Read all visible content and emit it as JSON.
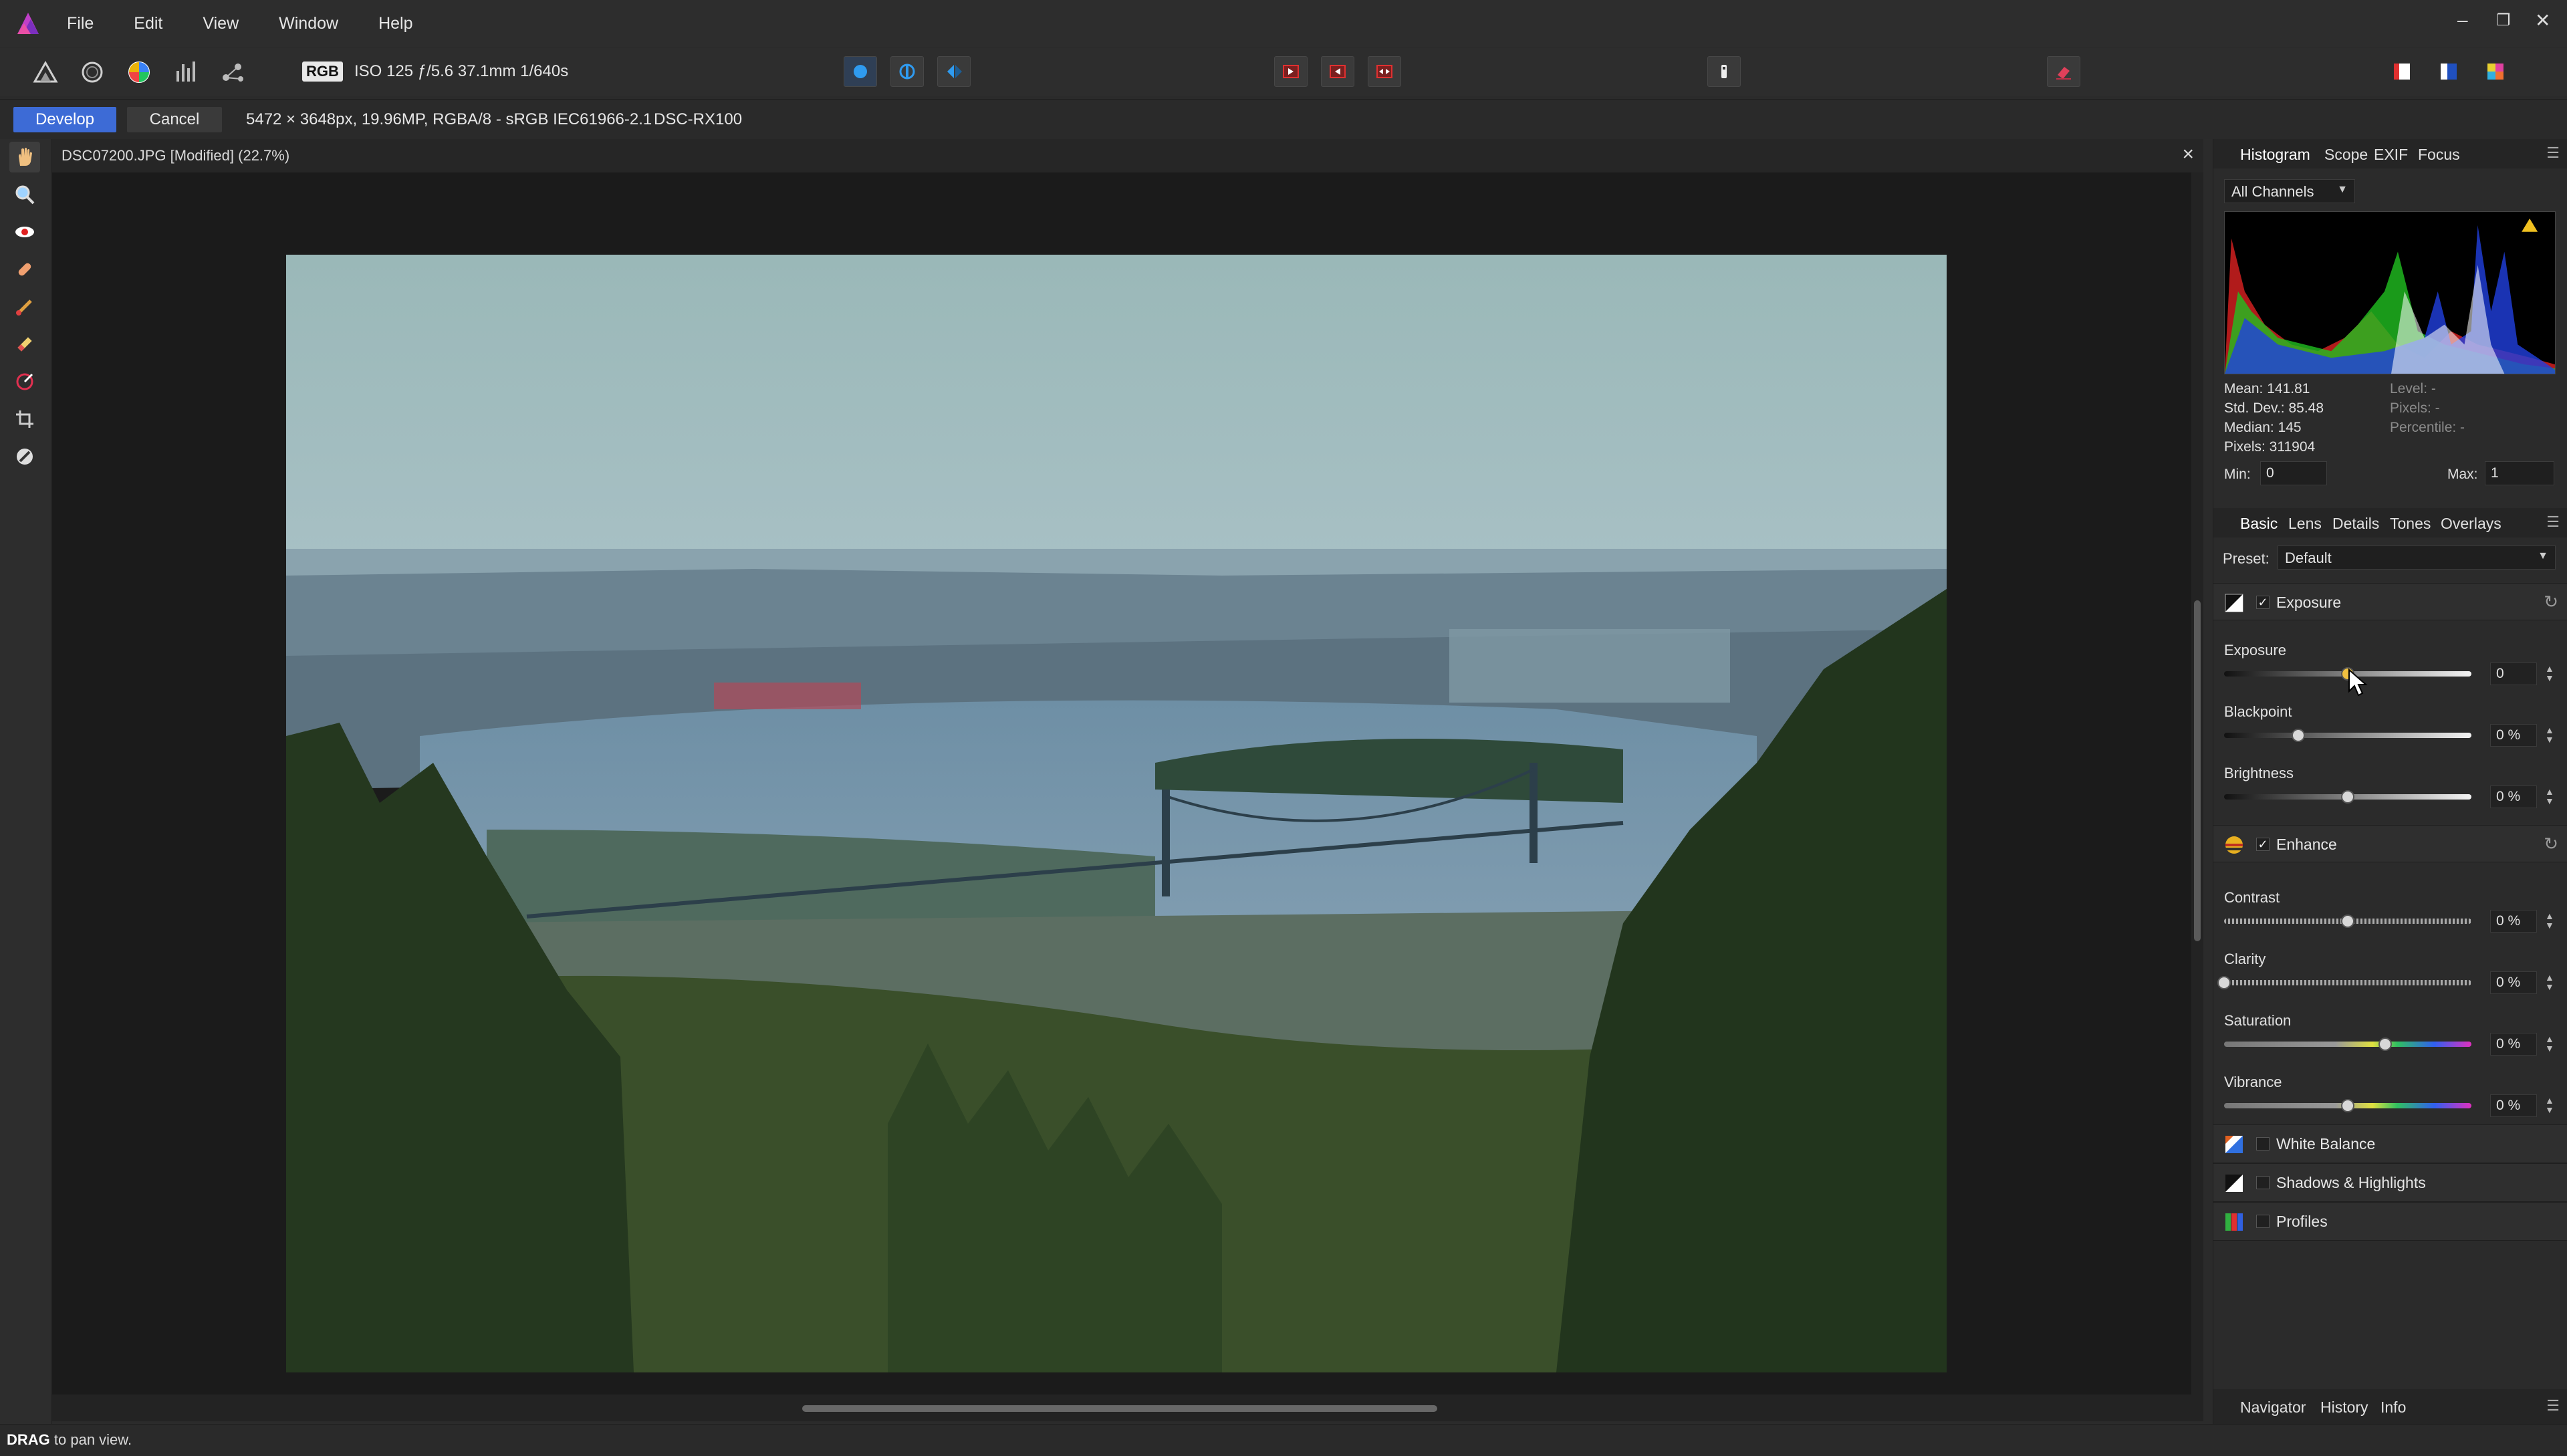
{
  "menubar": {
    "items": [
      "File",
      "Edit",
      "View",
      "Window",
      "Help"
    ],
    "window_controls": [
      "–",
      "❐",
      "✕"
    ]
  },
  "toolbar": {
    "color_mode": "RGB",
    "exif_summary": "ISO 125 ƒ/5.6 37.1mm 1/640s"
  },
  "context_bar": {
    "develop_label": "Develop",
    "cancel_label": "Cancel",
    "image_info": "5472 × 3648px, 19.96MP, RGBA/8 - sRGB IEC61966-2.1",
    "camera": "DSC-RX100"
  },
  "document": {
    "title": "DSC07200.JPG [Modified] (22.7%)",
    "close": "×"
  },
  "status": {
    "bold": "DRAG",
    "text": " to pan view."
  },
  "histogram_panel": {
    "tabs": [
      "Histogram",
      "Scope",
      "EXIF",
      "Focus"
    ],
    "channel": "All Channels",
    "stats": {
      "mean": "Mean: 141.81",
      "std": "Std. Dev.: 85.48",
      "median": "Median: 145",
      "pixels": "Pixels: 311904",
      "level": "Level: -",
      "pixels_sel": "Pixels: -",
      "percentile": "Percentile: -"
    },
    "min_label": "Min:",
    "min_value": "0",
    "max_label": "Max:",
    "max_value": "1"
  },
  "develop_panel": {
    "tabs": [
      "Basic",
      "Lens",
      "Details",
      "Tones",
      "Overlays"
    ],
    "preset_label": "Preset:",
    "preset_value": "Default",
    "sections": {
      "exposure": "Exposure",
      "enhance": "Enhance",
      "white_balance": "White Balance",
      "shadows_highlights": "Shadows & Highlights",
      "profiles": "Profiles"
    },
    "sliders": [
      {
        "label": "Exposure",
        "value": "0",
        "position": 0.5
      },
      {
        "label": "Blackpoint",
        "value": "0 %",
        "position": 0.3
      },
      {
        "label": "Brightness",
        "value": "0 %",
        "position": 0.5
      },
      {
        "label": "Contrast",
        "value": "0 %",
        "position": 0.5
      },
      {
        "label": "Clarity",
        "value": "0 %",
        "position": 0.0
      },
      {
        "label": "Saturation",
        "value": "0 %",
        "position": 0.65
      },
      {
        "label": "Vibrance",
        "value": "0 %",
        "position": 0.5
      }
    ]
  },
  "bottom_tabs": [
    "Navigator",
    "History",
    "Info"
  ],
  "colors": {
    "accent": "#3d6bd6",
    "background": "#2b2b2b",
    "canvas": "#1b1b1b"
  }
}
